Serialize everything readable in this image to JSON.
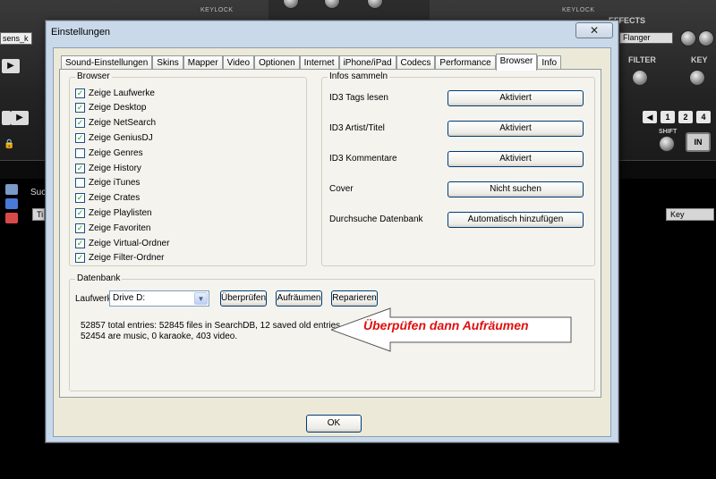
{
  "background_app": {
    "left_deck": {
      "keylock_label": "KEYLOCK",
      "input_text": "sens_k",
      "play_icon": "play-icon",
      "lock_icon": "lock-icon"
    },
    "right_deck": {
      "keylock_label": "KEYLOCK",
      "effects_label": "EFFECTS",
      "effect_value": "Flanger",
      "filter_label": "FILTER",
      "key_label": "KEY",
      "shift_label": "SHIFT",
      "in_label": "IN",
      "loop_buttons": [
        "1",
        "2",
        "4"
      ]
    },
    "browser": {
      "search_label": "Suc",
      "title_header": "Ti",
      "key_header": "Key"
    }
  },
  "dialog": {
    "title": "Einstellungen",
    "close_icon": "close-icon",
    "tabs": [
      {
        "label": "Sound-Einstellungen",
        "active": false
      },
      {
        "label": "Skins",
        "active": false
      },
      {
        "label": "Mapper",
        "active": false
      },
      {
        "label": "Video",
        "active": false
      },
      {
        "label": "Optionen",
        "active": false
      },
      {
        "label": "Internet",
        "active": false
      },
      {
        "label": "iPhone/iPad",
        "active": false
      },
      {
        "label": "Codecs",
        "active": false
      },
      {
        "label": "Performance",
        "active": false
      },
      {
        "label": "Browser",
        "active": true
      },
      {
        "label": "Info",
        "active": false
      }
    ],
    "browser_group": {
      "title": "Browser",
      "checkboxes": [
        {
          "label": "Zeige Laufwerke",
          "checked": true
        },
        {
          "label": "Zeige Desktop",
          "checked": true
        },
        {
          "label": "Zeige NetSearch",
          "checked": true
        },
        {
          "label": "Zeige GeniusDJ",
          "checked": true
        },
        {
          "label": "Zeige Genres",
          "checked": false
        },
        {
          "label": "Zeige History",
          "checked": true
        },
        {
          "label": "Zeige iTunes",
          "checked": false
        },
        {
          "label": "Zeige Crates",
          "checked": true
        },
        {
          "label": "Zeige Playlisten",
          "checked": true
        },
        {
          "label": "Zeige Favoriten",
          "checked": true
        },
        {
          "label": "Zeige Virtual-Ordner",
          "checked": true
        },
        {
          "label": "Zeige Filter-Ordner",
          "checked": true
        }
      ]
    },
    "info_group": {
      "title": "Infos sammeln",
      "rows": [
        {
          "label": "ID3 Tags lesen",
          "button": "Aktiviert"
        },
        {
          "label": "ID3 Artist/Titel",
          "button": "Aktiviert"
        },
        {
          "label": "ID3 Kommentare",
          "button": "Aktiviert"
        },
        {
          "label": "Cover",
          "button": "Nicht suchen"
        },
        {
          "label": "Durchsuche Datenbank",
          "button": "Automatisch hinzufügen"
        }
      ]
    },
    "database_group": {
      "title": "Datenbank",
      "drive_label": "Laufwerk",
      "drive_value": "Drive D:",
      "check_button": "Überprüfen",
      "cleanup_button": "Aufräumen",
      "repair_button": "Reparieren",
      "stats_line1": "52857 total entries: 52845 files in SearchDB, 12 saved old entries.",
      "stats_line2": "52454 are music, 0 karaoke, 403 video."
    },
    "annotation": "Überpüfen dann Aufräumen",
    "ok_button": "OK"
  }
}
